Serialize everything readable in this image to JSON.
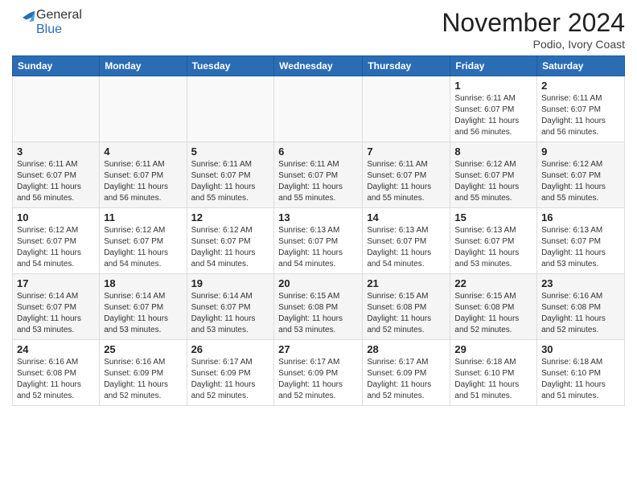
{
  "header": {
    "logo_general": "General",
    "logo_blue": "Blue",
    "month": "November 2024",
    "location": "Podio, Ivory Coast"
  },
  "weekdays": [
    "Sunday",
    "Monday",
    "Tuesday",
    "Wednesday",
    "Thursday",
    "Friday",
    "Saturday"
  ],
  "weeks": [
    [
      {
        "day": "",
        "info": ""
      },
      {
        "day": "",
        "info": ""
      },
      {
        "day": "",
        "info": ""
      },
      {
        "day": "",
        "info": ""
      },
      {
        "day": "",
        "info": ""
      },
      {
        "day": "1",
        "info": "Sunrise: 6:11 AM\nSunset: 6:07 PM\nDaylight: 11 hours\nand 56 minutes."
      },
      {
        "day": "2",
        "info": "Sunrise: 6:11 AM\nSunset: 6:07 PM\nDaylight: 11 hours\nand 56 minutes."
      }
    ],
    [
      {
        "day": "3",
        "info": "Sunrise: 6:11 AM\nSunset: 6:07 PM\nDaylight: 11 hours\nand 56 minutes."
      },
      {
        "day": "4",
        "info": "Sunrise: 6:11 AM\nSunset: 6:07 PM\nDaylight: 11 hours\nand 56 minutes."
      },
      {
        "day": "5",
        "info": "Sunrise: 6:11 AM\nSunset: 6:07 PM\nDaylight: 11 hours\nand 55 minutes."
      },
      {
        "day": "6",
        "info": "Sunrise: 6:11 AM\nSunset: 6:07 PM\nDaylight: 11 hours\nand 55 minutes."
      },
      {
        "day": "7",
        "info": "Sunrise: 6:11 AM\nSunset: 6:07 PM\nDaylight: 11 hours\nand 55 minutes."
      },
      {
        "day": "8",
        "info": "Sunrise: 6:12 AM\nSunset: 6:07 PM\nDaylight: 11 hours\nand 55 minutes."
      },
      {
        "day": "9",
        "info": "Sunrise: 6:12 AM\nSunset: 6:07 PM\nDaylight: 11 hours\nand 55 minutes."
      }
    ],
    [
      {
        "day": "10",
        "info": "Sunrise: 6:12 AM\nSunset: 6:07 PM\nDaylight: 11 hours\nand 54 minutes."
      },
      {
        "day": "11",
        "info": "Sunrise: 6:12 AM\nSunset: 6:07 PM\nDaylight: 11 hours\nand 54 minutes."
      },
      {
        "day": "12",
        "info": "Sunrise: 6:12 AM\nSunset: 6:07 PM\nDaylight: 11 hours\nand 54 minutes."
      },
      {
        "day": "13",
        "info": "Sunrise: 6:13 AM\nSunset: 6:07 PM\nDaylight: 11 hours\nand 54 minutes."
      },
      {
        "day": "14",
        "info": "Sunrise: 6:13 AM\nSunset: 6:07 PM\nDaylight: 11 hours\nand 54 minutes."
      },
      {
        "day": "15",
        "info": "Sunrise: 6:13 AM\nSunset: 6:07 PM\nDaylight: 11 hours\nand 53 minutes."
      },
      {
        "day": "16",
        "info": "Sunrise: 6:13 AM\nSunset: 6:07 PM\nDaylight: 11 hours\nand 53 minutes."
      }
    ],
    [
      {
        "day": "17",
        "info": "Sunrise: 6:14 AM\nSunset: 6:07 PM\nDaylight: 11 hours\nand 53 minutes."
      },
      {
        "day": "18",
        "info": "Sunrise: 6:14 AM\nSunset: 6:07 PM\nDaylight: 11 hours\nand 53 minutes."
      },
      {
        "day": "19",
        "info": "Sunrise: 6:14 AM\nSunset: 6:07 PM\nDaylight: 11 hours\nand 53 minutes."
      },
      {
        "day": "20",
        "info": "Sunrise: 6:15 AM\nSunset: 6:08 PM\nDaylight: 11 hours\nand 53 minutes."
      },
      {
        "day": "21",
        "info": "Sunrise: 6:15 AM\nSunset: 6:08 PM\nDaylight: 11 hours\nand 52 minutes."
      },
      {
        "day": "22",
        "info": "Sunrise: 6:15 AM\nSunset: 6:08 PM\nDaylight: 11 hours\nand 52 minutes."
      },
      {
        "day": "23",
        "info": "Sunrise: 6:16 AM\nSunset: 6:08 PM\nDaylight: 11 hours\nand 52 minutes."
      }
    ],
    [
      {
        "day": "24",
        "info": "Sunrise: 6:16 AM\nSunset: 6:08 PM\nDaylight: 11 hours\nand 52 minutes."
      },
      {
        "day": "25",
        "info": "Sunrise: 6:16 AM\nSunset: 6:09 PM\nDaylight: 11 hours\nand 52 minutes."
      },
      {
        "day": "26",
        "info": "Sunrise: 6:17 AM\nSunset: 6:09 PM\nDaylight: 11 hours\nand 52 minutes."
      },
      {
        "day": "27",
        "info": "Sunrise: 6:17 AM\nSunset: 6:09 PM\nDaylight: 11 hours\nand 52 minutes."
      },
      {
        "day": "28",
        "info": "Sunrise: 6:17 AM\nSunset: 6:09 PM\nDaylight: 11 hours\nand 52 minutes."
      },
      {
        "day": "29",
        "info": "Sunrise: 6:18 AM\nSunset: 6:10 PM\nDaylight: 11 hours\nand 51 minutes."
      },
      {
        "day": "30",
        "info": "Sunrise: 6:18 AM\nSunset: 6:10 PM\nDaylight: 11 hours\nand 51 minutes."
      }
    ]
  ]
}
